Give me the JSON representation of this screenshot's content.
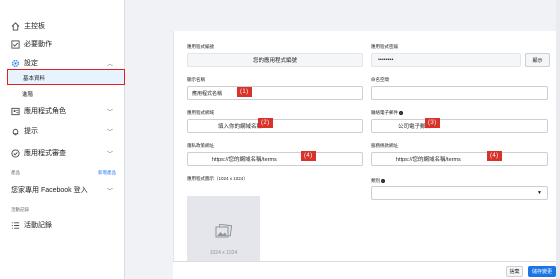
{
  "sidebar": {
    "items": [
      {
        "label": "主控板",
        "icon": "home-icon"
      },
      {
        "label": "必要動作",
        "icon": "checklist-icon"
      },
      {
        "label": "設定",
        "icon": "gear-icon"
      },
      {
        "label": "應用程式角色",
        "icon": "roles-icon"
      },
      {
        "label": "提示",
        "icon": "bell-icon"
      },
      {
        "label": "應用程式審查",
        "icon": "shield-check-icon"
      },
      {
        "label": "您家專用 Facebook 登入",
        "icon": ""
      },
      {
        "label": "活動記錄",
        "icon": "list-icon"
      }
    ],
    "settings_sub": {
      "basic": "基本資料",
      "advanced": "進階"
    },
    "products_header": "產品",
    "products_link": "新增產品",
    "activity_header": "活動記錄"
  },
  "form": {
    "app_id": {
      "label": "應用程式編號",
      "value": "您的應用程式編號"
    },
    "app_secret": {
      "label": "應用程式密鑰",
      "value": "••••••••",
      "show_label": "顯示"
    },
    "display_name": {
      "label": "顯示名稱",
      "value": "應用程式名稱",
      "annotation": "(1)"
    },
    "namespace": {
      "label": "命名空間",
      "value": ""
    },
    "app_domain": {
      "label": "應用程式網域",
      "value": "填入你的網域名稱",
      "annotation": "(2)"
    },
    "contact_email": {
      "label": "聯絡電子郵件",
      "value": "公司電子郵件",
      "annotation": "(3)"
    },
    "privacy_url": {
      "label": "隱私政策網址",
      "value": "https://您的網域名稱/terms",
      "annotation": "(4)"
    },
    "terms_url": {
      "label": "服務條款網址",
      "value": "https://您的網域名稱/terms",
      "annotation": "(4)"
    },
    "app_icon": {
      "label": "應用程式圖示（1024 x 1024）",
      "caption": "1024 x 1024"
    },
    "category": {
      "label": "類別",
      "value": ""
    }
  },
  "footer": {
    "discard": "捨棄",
    "save": "儲存變更"
  },
  "colors": {
    "accent": "#1877f2",
    "annotation": "#d8322b",
    "selected_border": "#e02020"
  }
}
